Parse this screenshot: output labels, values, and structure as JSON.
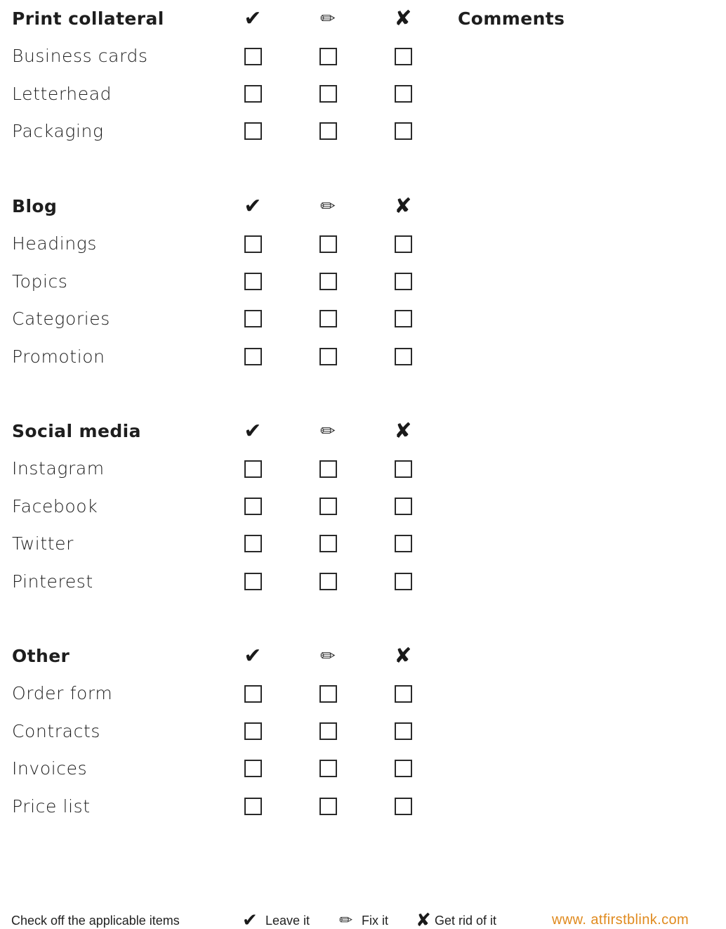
{
  "icons": {
    "leave": "check-mark-icon",
    "fix": "pencil-icon",
    "remove": "cross-mark-icon"
  },
  "glyphs": {
    "leave": "✔",
    "fix": "✏",
    "remove": "✘"
  },
  "comments_label": "Comments",
  "sections": [
    {
      "title": "Print collateral",
      "items": [
        "Business cards",
        "Letterhead",
        "Packaging"
      ]
    },
    {
      "title": "Blog",
      "items": [
        "Headings",
        "Topics",
        "Categories",
        "Promotion"
      ]
    },
    {
      "title": "Social media",
      "items": [
        "Instagram",
        "Facebook",
        "Twitter",
        "Pinterest"
      ]
    },
    {
      "title": "Other",
      "items": [
        "Order form",
        "Contracts",
        "Invoices",
        "Price list"
      ]
    }
  ],
  "footer": {
    "instruction": "Check off the applicable items",
    "leave_label": "Leave it",
    "fix_label": "Fix it",
    "remove_label": "Get rid of it",
    "website": "www. atfirstblink.com"
  },
  "colors": {
    "text": "#1e1e1e",
    "accent": "#e08a1e"
  }
}
